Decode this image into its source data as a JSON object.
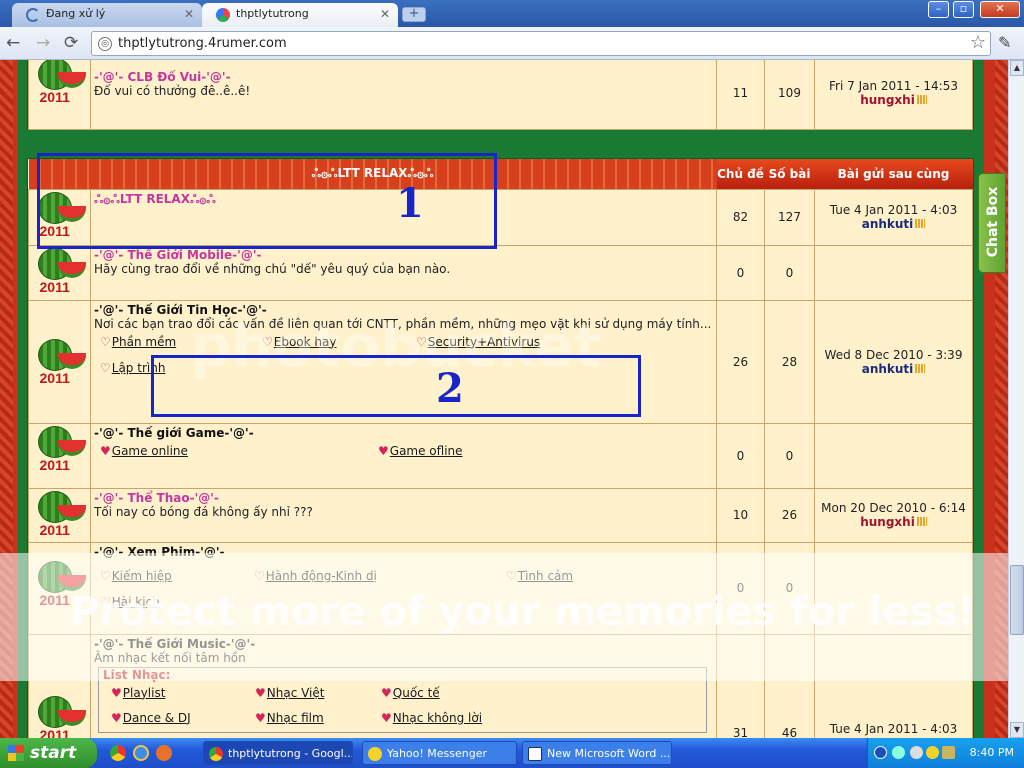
{
  "browser": {
    "tabs": [
      {
        "title": "Đang xử lý",
        "active": false
      },
      {
        "title": "thptlytutrong",
        "active": true
      }
    ],
    "new_tab": "+",
    "window_buttons": [
      "–",
      "▫",
      "✕"
    ],
    "address": "thptlytutrong.4rumer.com",
    "back": "←",
    "forward": "→",
    "reload": "⟳",
    "star": "☆",
    "wrench": "🔧"
  },
  "forum": {
    "row_clb": {
      "name": "-'@'- CLB Đố Vui-'@'-",
      "desc": "Đố vui có thưởng đê..ê..ê!",
      "topics": "11",
      "posts": "109",
      "last_date": "Fri 7 Jan 2011 - 14:53",
      "last_author": "hungxhi"
    },
    "header": {
      "title": "ஃ۞ஃLTT RELAXஃ۞ஃ",
      "col_topics": "Chủ đề",
      "col_posts": "Số bài",
      "col_last": "Bài gửi sau cùng"
    },
    "rows": [
      {
        "name": "ஃ۞ஃLTT RELAXஃ۞ஃ",
        "desc": "",
        "topics": "82",
        "posts": "127",
        "last_date": "Tue 4 Jan 2011 - 4:03",
        "last_author": "anhkuti"
      },
      {
        "name": "-'@'- Thế Giới Mobile-'@'-",
        "desc": "Hãy cùng trao đổi về những chú \"dế\" yêu quý của bạn nào.",
        "topics": "0",
        "posts": "0",
        "last_date": "",
        "last_author": ""
      },
      {
        "name": "-'@'- Thế Giới Tin Học-'@'-",
        "desc": "Nơi các bạn trao đổi các vấn đề liên quan tới CNTT, phần mềm, những mẹo vặt khi sử dụng máy tính...",
        "subs": [
          "Phần mềm",
          "Ebook hay",
          "Security+Antivirus",
          "Lập trình"
        ],
        "topics": "26",
        "posts": "28",
        "last_date": "Wed 8 Dec 2010 - 3:39",
        "last_author": "anhkuti"
      },
      {
        "name": "-'@'- Thế giới Game-'@'-",
        "desc": "",
        "subs": [
          "Game online",
          "Game ofline"
        ],
        "topics": "0",
        "posts": "0",
        "last_date": "",
        "last_author": ""
      },
      {
        "name": "-'@'- Thể Thao-'@'-",
        "desc": "Tối nay có bóng đá không ấy nhỉ ???",
        "topics": "10",
        "posts": "26",
        "last_date": "Mon 20 Dec 2010 - 6:14",
        "last_author": "hungxhi"
      },
      {
        "name": "-'@'- Xem Phim-'@'-",
        "desc": "",
        "subs": [
          "Kiếm hiệp",
          "Hành động-Kinh dị",
          "Tình cảm",
          "Hài kịch"
        ],
        "topics": "0",
        "posts": "0",
        "last_date": "",
        "last_author": ""
      },
      {
        "name": "-'@'- Thế Giới Music-'@'-",
        "desc": "Âm nhạc kết nối tâm hồn",
        "list_title": "List Nhạc:",
        "subs": [
          "Playlist",
          "Nhạc Việt",
          "Quốc tế",
          "Dance & DJ",
          "Nhạc film",
          "Nhạc không lời"
        ],
        "topics": "31",
        "posts": "46",
        "last_date": "Tue 4 Jan 2011 - 4:03",
        "last_author": ""
      }
    ],
    "year": "2011"
  },
  "annotations": {
    "one": "1",
    "two": "2"
  },
  "watermark": {
    "line1": "photobucket",
    "line2": "Protect more of your memories for less!"
  },
  "chatbox": "Chat Box",
  "taskbar": {
    "start": "start",
    "buttons": [
      "thptlytutrong - Googl...",
      "Yahoo! Messenger",
      "New Microsoft Word ..."
    ],
    "clock": "8:40 PM"
  },
  "colors": {
    "annotation": "#1826c9",
    "forum_green": "#1a7a33",
    "cream": "#fff1cc",
    "header_red": "#c8321c"
  }
}
